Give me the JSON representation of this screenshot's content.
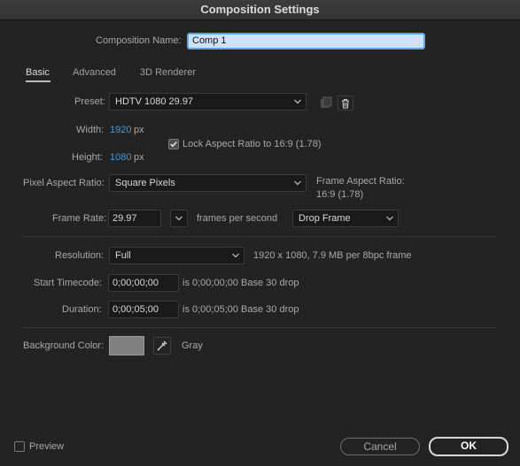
{
  "window": {
    "title": "Composition Settings"
  },
  "comp_name": {
    "label": "Composition Name:",
    "value": "Comp 1"
  },
  "tabs": [
    {
      "label": "Basic",
      "active": true
    },
    {
      "label": "Advanced",
      "active": false
    },
    {
      "label": "3D Renderer",
      "active": false
    }
  ],
  "preset": {
    "label": "Preset:",
    "value": "HDTV 1080 29.97"
  },
  "width": {
    "label": "Width:",
    "value": "1920",
    "unit": "px"
  },
  "height": {
    "label": "Height:",
    "value": "1080",
    "unit": "px"
  },
  "lock_aspect": {
    "label": "Lock Aspect Ratio to 16:9 (1.78)",
    "checked": true
  },
  "pixel_aspect": {
    "label": "Pixel Aspect Ratio:",
    "value": "Square Pixels"
  },
  "frame_aspect": {
    "label": "Frame Aspect Ratio:",
    "value": "16:9 (1.78)"
  },
  "frame_rate": {
    "label": "Frame Rate:",
    "value": "29.97",
    "unit": "frames per second",
    "mode": "Drop Frame"
  },
  "resolution": {
    "label": "Resolution:",
    "value": "Full",
    "info": "1920 x 1080, 7.9 MB per 8bpc frame"
  },
  "start_timecode": {
    "label": "Start Timecode:",
    "value": "0;00;00;00",
    "info": "is 0;00;00;00  Base 30  drop"
  },
  "duration": {
    "label": "Duration:",
    "value": "0;00;05;00",
    "info": "is 0;00;05;00  Base 30  drop"
  },
  "background": {
    "label": "Background Color:",
    "color_name": "Gray",
    "swatch": "#808080"
  },
  "footer": {
    "preview_label": "Preview",
    "preview_checked": false,
    "cancel_label": "Cancel",
    "ok_label": "OK"
  },
  "colors": {
    "accent": "#3d9ae8",
    "panel": "#232323",
    "field": "#1a1a1a",
    "name_field": "#cfe2fb",
    "name_border": "#5ea2ec"
  }
}
